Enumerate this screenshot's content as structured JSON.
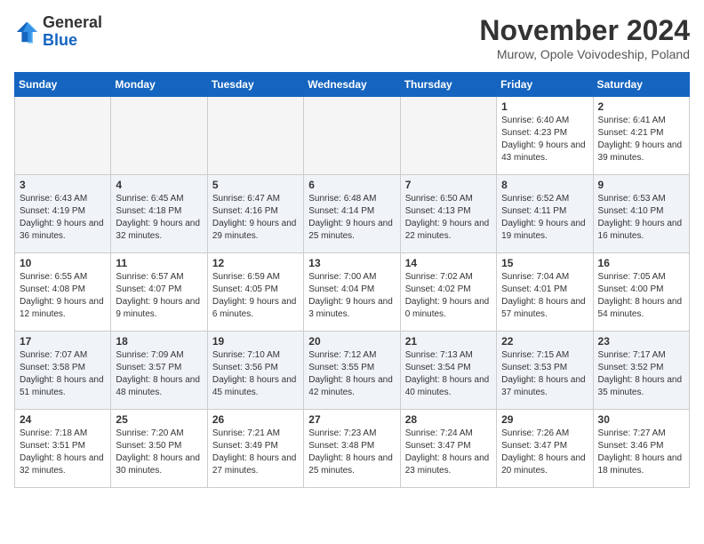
{
  "logo": {
    "general": "General",
    "blue": "Blue"
  },
  "title": "November 2024",
  "location": "Murow, Opole Voivodeship, Poland",
  "weekdays": [
    "Sunday",
    "Monday",
    "Tuesday",
    "Wednesday",
    "Thursday",
    "Friday",
    "Saturday"
  ],
  "weeks": [
    [
      {
        "day": "",
        "info": ""
      },
      {
        "day": "",
        "info": ""
      },
      {
        "day": "",
        "info": ""
      },
      {
        "day": "",
        "info": ""
      },
      {
        "day": "",
        "info": ""
      },
      {
        "day": "1",
        "info": "Sunrise: 6:40 AM\nSunset: 4:23 PM\nDaylight: 9 hours and 43 minutes."
      },
      {
        "day": "2",
        "info": "Sunrise: 6:41 AM\nSunset: 4:21 PM\nDaylight: 9 hours and 39 minutes."
      }
    ],
    [
      {
        "day": "3",
        "info": "Sunrise: 6:43 AM\nSunset: 4:19 PM\nDaylight: 9 hours and 36 minutes."
      },
      {
        "day": "4",
        "info": "Sunrise: 6:45 AM\nSunset: 4:18 PM\nDaylight: 9 hours and 32 minutes."
      },
      {
        "day": "5",
        "info": "Sunrise: 6:47 AM\nSunset: 4:16 PM\nDaylight: 9 hours and 29 minutes."
      },
      {
        "day": "6",
        "info": "Sunrise: 6:48 AM\nSunset: 4:14 PM\nDaylight: 9 hours and 25 minutes."
      },
      {
        "day": "7",
        "info": "Sunrise: 6:50 AM\nSunset: 4:13 PM\nDaylight: 9 hours and 22 minutes."
      },
      {
        "day": "8",
        "info": "Sunrise: 6:52 AM\nSunset: 4:11 PM\nDaylight: 9 hours and 19 minutes."
      },
      {
        "day": "9",
        "info": "Sunrise: 6:53 AM\nSunset: 4:10 PM\nDaylight: 9 hours and 16 minutes."
      }
    ],
    [
      {
        "day": "10",
        "info": "Sunrise: 6:55 AM\nSunset: 4:08 PM\nDaylight: 9 hours and 12 minutes."
      },
      {
        "day": "11",
        "info": "Sunrise: 6:57 AM\nSunset: 4:07 PM\nDaylight: 9 hours and 9 minutes."
      },
      {
        "day": "12",
        "info": "Sunrise: 6:59 AM\nSunset: 4:05 PM\nDaylight: 9 hours and 6 minutes."
      },
      {
        "day": "13",
        "info": "Sunrise: 7:00 AM\nSunset: 4:04 PM\nDaylight: 9 hours and 3 minutes."
      },
      {
        "day": "14",
        "info": "Sunrise: 7:02 AM\nSunset: 4:02 PM\nDaylight: 9 hours and 0 minutes."
      },
      {
        "day": "15",
        "info": "Sunrise: 7:04 AM\nSunset: 4:01 PM\nDaylight: 8 hours and 57 minutes."
      },
      {
        "day": "16",
        "info": "Sunrise: 7:05 AM\nSunset: 4:00 PM\nDaylight: 8 hours and 54 minutes."
      }
    ],
    [
      {
        "day": "17",
        "info": "Sunrise: 7:07 AM\nSunset: 3:58 PM\nDaylight: 8 hours and 51 minutes."
      },
      {
        "day": "18",
        "info": "Sunrise: 7:09 AM\nSunset: 3:57 PM\nDaylight: 8 hours and 48 minutes."
      },
      {
        "day": "19",
        "info": "Sunrise: 7:10 AM\nSunset: 3:56 PM\nDaylight: 8 hours and 45 minutes."
      },
      {
        "day": "20",
        "info": "Sunrise: 7:12 AM\nSunset: 3:55 PM\nDaylight: 8 hours and 42 minutes."
      },
      {
        "day": "21",
        "info": "Sunrise: 7:13 AM\nSunset: 3:54 PM\nDaylight: 8 hours and 40 minutes."
      },
      {
        "day": "22",
        "info": "Sunrise: 7:15 AM\nSunset: 3:53 PM\nDaylight: 8 hours and 37 minutes."
      },
      {
        "day": "23",
        "info": "Sunrise: 7:17 AM\nSunset: 3:52 PM\nDaylight: 8 hours and 35 minutes."
      }
    ],
    [
      {
        "day": "24",
        "info": "Sunrise: 7:18 AM\nSunset: 3:51 PM\nDaylight: 8 hours and 32 minutes."
      },
      {
        "day": "25",
        "info": "Sunrise: 7:20 AM\nSunset: 3:50 PM\nDaylight: 8 hours and 30 minutes."
      },
      {
        "day": "26",
        "info": "Sunrise: 7:21 AM\nSunset: 3:49 PM\nDaylight: 8 hours and 27 minutes."
      },
      {
        "day": "27",
        "info": "Sunrise: 7:23 AM\nSunset: 3:48 PM\nDaylight: 8 hours and 25 minutes."
      },
      {
        "day": "28",
        "info": "Sunrise: 7:24 AM\nSunset: 3:47 PM\nDaylight: 8 hours and 23 minutes."
      },
      {
        "day": "29",
        "info": "Sunrise: 7:26 AM\nSunset: 3:47 PM\nDaylight: 8 hours and 20 minutes."
      },
      {
        "day": "30",
        "info": "Sunrise: 7:27 AM\nSunset: 3:46 PM\nDaylight: 8 hours and 18 minutes."
      }
    ]
  ]
}
